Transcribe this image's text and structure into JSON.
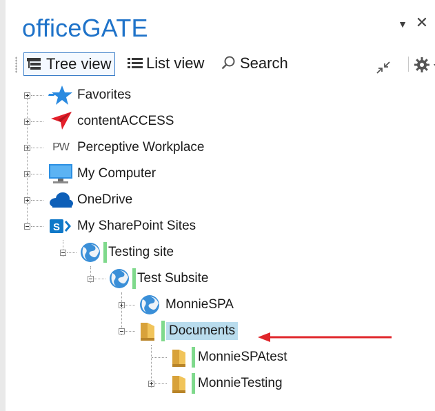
{
  "window": {
    "title": "officeGATE"
  },
  "toolbar": {
    "tree_view": "Tree view",
    "list_view": "List view",
    "search": "Search"
  },
  "tree": {
    "nodes": [
      {
        "label": "Favorites",
        "icon": "star-icon"
      },
      {
        "label": "contentACCESS",
        "icon": "contentaccess-logo-icon"
      },
      {
        "label": "Perceptive Workplace",
        "icon": "pw-logo-icon",
        "icon_text": "PW"
      },
      {
        "label": "My Computer",
        "icon": "computer-icon"
      },
      {
        "label": "OneDrive",
        "icon": "cloud-icon"
      },
      {
        "label": "My SharePoint Sites",
        "icon": "sharepoint-icon"
      },
      {
        "label": "Testing site",
        "icon": "globe-icon"
      },
      {
        "label": "Test Subsite",
        "icon": "globe-icon"
      },
      {
        "label": "MonnieSPA",
        "icon": "globe-icon"
      },
      {
        "label": "Documents",
        "icon": "folder-open-icon",
        "selected": true
      },
      {
        "label": "MonnieSPAtest",
        "icon": "folder-icon"
      },
      {
        "label": "MonnieTesting",
        "icon": "folder-icon"
      }
    ]
  },
  "colors": {
    "title": "#1f73c9",
    "selection": "#b9dced",
    "marker": "#7fd98c",
    "arrow": "#e0262b"
  }
}
